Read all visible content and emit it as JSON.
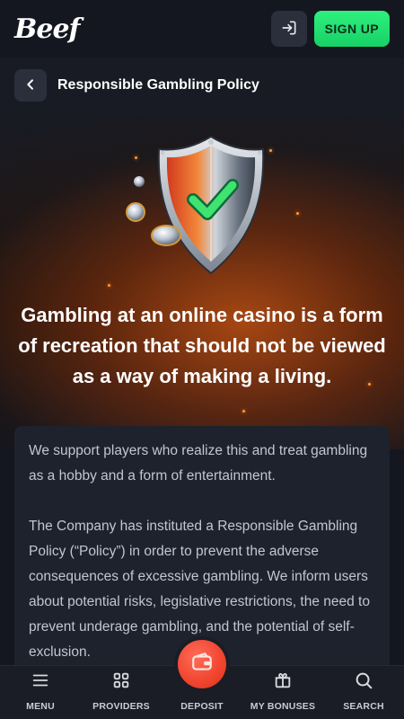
{
  "header": {
    "logo": "Beef",
    "login_icon": "login-icon",
    "signup_label": "SIGN UP"
  },
  "title_bar": {
    "back_icon": "chevron-left-icon",
    "title": "Responsible Gambling Policy"
  },
  "hero": {
    "image": "shield-checkmark-icon",
    "headline": "Gambling at an online casino is a form of recreation that should not be viewed as a way of making a living."
  },
  "content": {
    "paragraphs": [
      "We support players who realize this and treat gambling as a hobby and a form of entertainment.",
      "The Company has instituted a Responsible Gambling Policy (“Policy”) in order to prevent the adverse consequences of excessive gambling. We inform users about potential risks, legislative restrictions, the need to prevent underage gambling, and the potential of self-exclusion."
    ]
  },
  "bottom_nav": {
    "items": [
      {
        "label": "MENU",
        "icon": "menu-icon"
      },
      {
        "label": "PROVIDERS",
        "icon": "grid-icon"
      },
      {
        "label": "DEPOSIT",
        "icon": "wallet-icon"
      },
      {
        "label": "MY BONUSES",
        "icon": "gift-icon"
      },
      {
        "label": "SEARCH",
        "icon": "search-icon"
      }
    ]
  },
  "colors": {
    "background": "#14171f",
    "card": "#1e222c",
    "signup_green": "#2ef07e",
    "deposit_red": "#f0442e",
    "hero_glow": "#be5014"
  }
}
